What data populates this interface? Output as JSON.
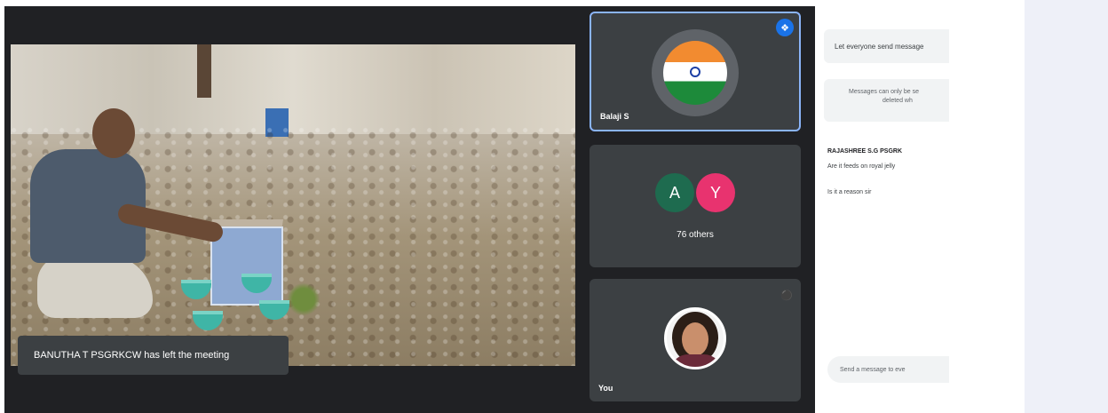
{
  "notification": {
    "text": "BANUTHA T PSGRKCW has left the meeting"
  },
  "participants": {
    "tile1": {
      "name": "Balaji S",
      "speaking_icon": "audio-wave-icon"
    },
    "tile2": {
      "avatars": [
        {
          "letter": "A",
          "color": "#1e6b4f"
        },
        {
          "letter": "Y",
          "color": "#e8336f"
        }
      ],
      "label": "76 others"
    },
    "tile3": {
      "name": "You",
      "mute_icon": "mic-off-icon"
    }
  },
  "chat": {
    "toggle_text": "Let everyone send message",
    "info_line1": "Messages can only be se",
    "info_line2": "deleted wh",
    "message": {
      "sender": "RAJASHREE S.G PSGRK",
      "lines": [
        "Are it feeds on royal jelly",
        "Is it a reason sir"
      ]
    },
    "input_placeholder": "Send a message to eve"
  },
  "colors": {
    "accent": "#8ab4f8",
    "meeting_bg": "#202124",
    "tile_bg": "#3c4043"
  }
}
